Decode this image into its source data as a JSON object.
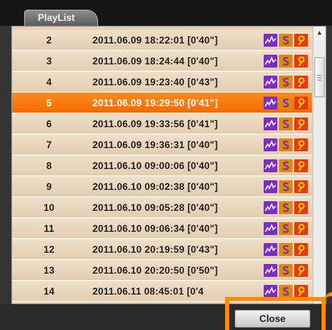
{
  "tab": {
    "label": "PlayList"
  },
  "rows": [
    {
      "num": "2",
      "timestamp": "2011.06.09 18:22:01 [0'40\"]",
      "selected": false
    },
    {
      "num": "3",
      "timestamp": "2011.06.09 18:24:44 [0'40\"]",
      "selected": false
    },
    {
      "num": "4",
      "timestamp": "2011.06.09 19:23:40 [0'43\"]",
      "selected": false
    },
    {
      "num": "5",
      "timestamp": "2011.06.09 19:29:50 [0'41\"]",
      "selected": true
    },
    {
      "num": "6",
      "timestamp": "2011.06.09 19:33:56 [0'41\"]",
      "selected": false
    },
    {
      "num": "7",
      "timestamp": "2011.06.09 19:36:31 [0'40\"]",
      "selected": false
    },
    {
      "num": "8",
      "timestamp": "2011.06.10 09:00:06 [0'40\"]",
      "selected": false
    },
    {
      "num": "9",
      "timestamp": "2011.06.10 09:02:38 [0'40\"]",
      "selected": false
    },
    {
      "num": "10",
      "timestamp": "2011.06.10 09:05:28 [0'40\"]",
      "selected": false
    },
    {
      "num": "11",
      "timestamp": "2011.06.10 09:06:34 [0'40\"]",
      "selected": false
    },
    {
      "num": "12",
      "timestamp": "2011.06.10 20:19:59 [0'43\"]",
      "selected": false
    },
    {
      "num": "13",
      "timestamp": "2011.06.10 20:20:50 [0'50\"]",
      "selected": false
    },
    {
      "num": "14",
      "timestamp": "2011.06.11 08:45:01 [0'4",
      "selected": false
    }
  ],
  "row_icons": [
    "motion-graph-icon",
    "speed-s-icon",
    "gps-pin-icon"
  ],
  "colors": {
    "row_bg": "#e6d2b8",
    "selected_bg": "#f26b00",
    "motion_icon": "#7a2fbf",
    "speed_icon": "#e08a00",
    "gps_icon": "#e23c14",
    "highlight": "#ff8c00"
  },
  "scrollbar": {
    "position": 0.08
  },
  "footer": {
    "close_label": "Close"
  }
}
